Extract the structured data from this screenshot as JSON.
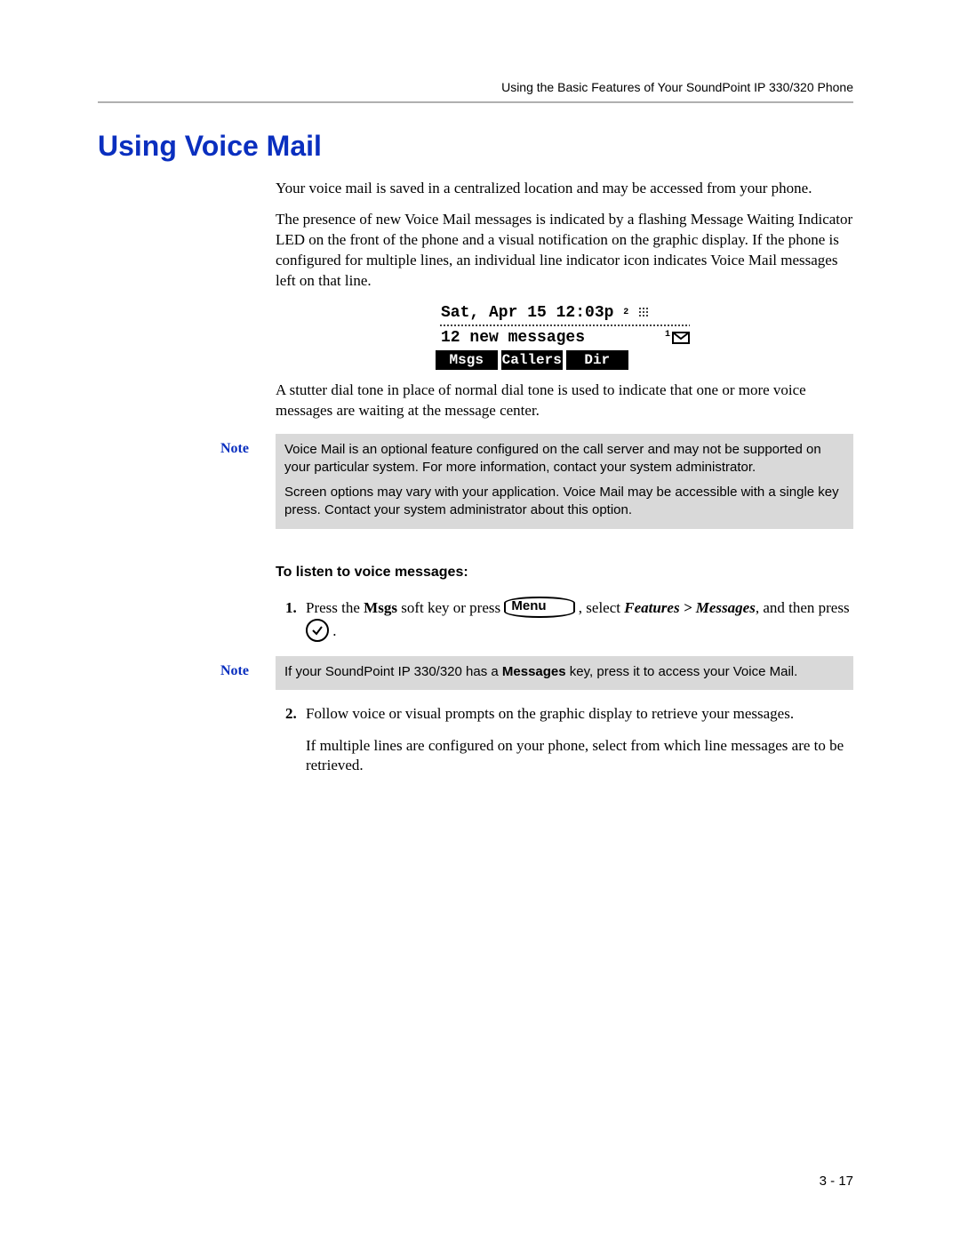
{
  "header": {
    "running_head": "Using the Basic Features of Your SoundPoint IP 330/320 Phone"
  },
  "title": "Using Voice Mail",
  "paragraphs": {
    "p1": "Your voice mail is saved in a centralized location and may be accessed from your phone.",
    "p2": "The presence of new Voice Mail messages is indicated by a flashing Message Waiting Indicator LED on the front of the phone and a visual notification on the graphic display. If the phone is configured for multiple lines, an individual line indicator icon indicates Voice Mail messages left on that line.",
    "p3": "A stutter dial tone in place of normal dial tone is used to indicate that one or more voice messages are waiting at the message center."
  },
  "lcd": {
    "datetime": "Sat, Apr 15 12:03p",
    "super": "2",
    "message_line": "12 new messages",
    "msg_count_sup": "1",
    "softkeys": [
      "Msgs",
      "Callers",
      "Dir",
      ""
    ]
  },
  "notes": {
    "label": "Note",
    "n1a": "Voice Mail is an optional feature configured on the call server and may not be supported on your particular system. For more information, contact your system administrator.",
    "n1b": "Screen options may vary with your application. Voice Mail may be accessible with a single key press. Contact your system administrator about this option.",
    "n2_prefix": "If your SoundPoint IP 330/320 has a ",
    "n2_bold": "Messages",
    "n2_suffix": " key, press it to access your Voice Mail."
  },
  "sub_heading": "To listen to voice messages:",
  "steps": {
    "s1_a": "Press the ",
    "s1_b": "Msgs",
    "s1_c": " soft key or press ",
    "s1_menu": "Menu",
    "s1_d": " , select ",
    "s1_e": "Features > Messages",
    "s1_f": ", and then press ",
    "s1_g": " .",
    "s2a": "Follow voice or visual prompts on the graphic display to retrieve your messages.",
    "s2b": "If multiple lines are configured on your phone, select from which line messages are to be retrieved."
  },
  "page_number": "3 - 17"
}
